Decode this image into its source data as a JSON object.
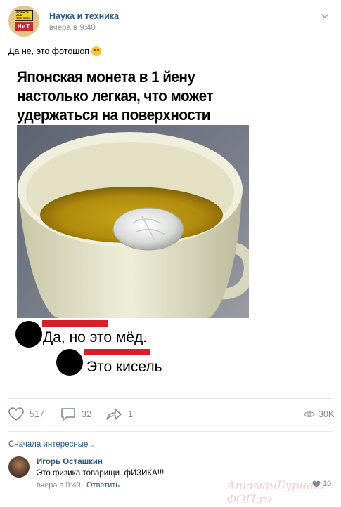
{
  "post": {
    "group_name": "Наука и техника",
    "time": "вчера в 9:40",
    "text": "Да не, это фотошоп",
    "emoji_icon": "rofl-emoji-icon",
    "avatar_logo_top": "SCIENCE AND TECHNICS",
    "avatar_logo_bottom": "НиТ"
  },
  "meme": {
    "title": "Японская монета в 1 йену настолько легкая, что может удержаться на поверхности воды",
    "reply1": "Да, но это мёд.",
    "reply2": "Это кисель"
  },
  "actions": {
    "likes": "517",
    "comments": "32",
    "shares": "1",
    "views": "30K"
  },
  "comments_section": {
    "sort_label": "Сначала интересные",
    "items": [
      {
        "author": "Игорь Осташкин",
        "text": "Это физика товарищи. фИЗИКА!!!",
        "time": "вчера в 9:49",
        "reply_label": "Ответить",
        "likes": "10"
      }
    ]
  },
  "watermark": "АтаманБурнаш ФОП.ru",
  "colors": {
    "link": "#2a5885",
    "muted": "#939393",
    "icon": "#828a99",
    "accent_red": "#d91e2a"
  }
}
